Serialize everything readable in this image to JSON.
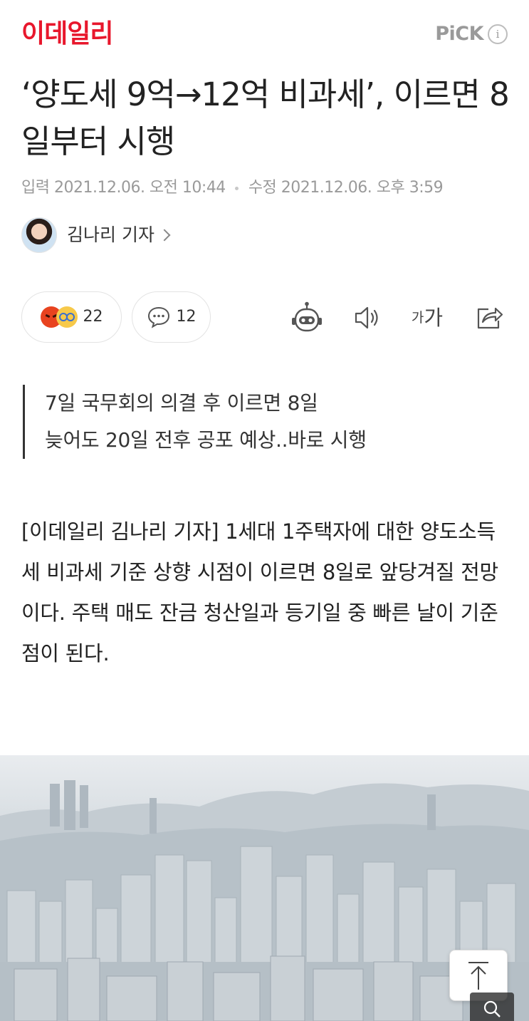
{
  "header": {
    "logo": "이데일리",
    "pick_label": "PiCK",
    "pick_info_glyph": "i"
  },
  "article": {
    "title": "‘양도세 9억→12억 비과세’, 이르면 8일부터 시행",
    "input_label": "입력",
    "input_datetime": "2021.12.06. 오전 10:44",
    "modified_label": "수정",
    "modified_datetime": "2021.12.06. 오후 3:59",
    "author": "김나리 기자"
  },
  "reactions": {
    "count": "22",
    "comment_count": "12"
  },
  "tools": {
    "font_small": "가",
    "font_big": "가"
  },
  "summary": [
    "7일 국무회의 의결 후 이르면 8일",
    "늦어도 20일 전후 공포 예상..바로 시행"
  ],
  "body": "[이데일리 김나리 기자] 1세대 1주택자에 대한 양도소득세 비과세 기준 상향 시점이 이르면 8일로 앞당겨질 전망이다. 주택 매도 잔금 청산일과 등기일 중 빠른 날이 기준점이 된다.",
  "colors": {
    "brand": "#e8172c",
    "muted": "#9a9a9a",
    "text": "#222222"
  },
  "icons": {
    "reaction_1": "angry-face-icon",
    "reaction_2": "nerd-face-icon",
    "comment": "comment-icon",
    "robot": "robot-summary-icon",
    "sound": "speaker-icon",
    "share": "share-icon",
    "scroll_top": "arrow-up-icon",
    "zoom": "zoom-icon"
  }
}
